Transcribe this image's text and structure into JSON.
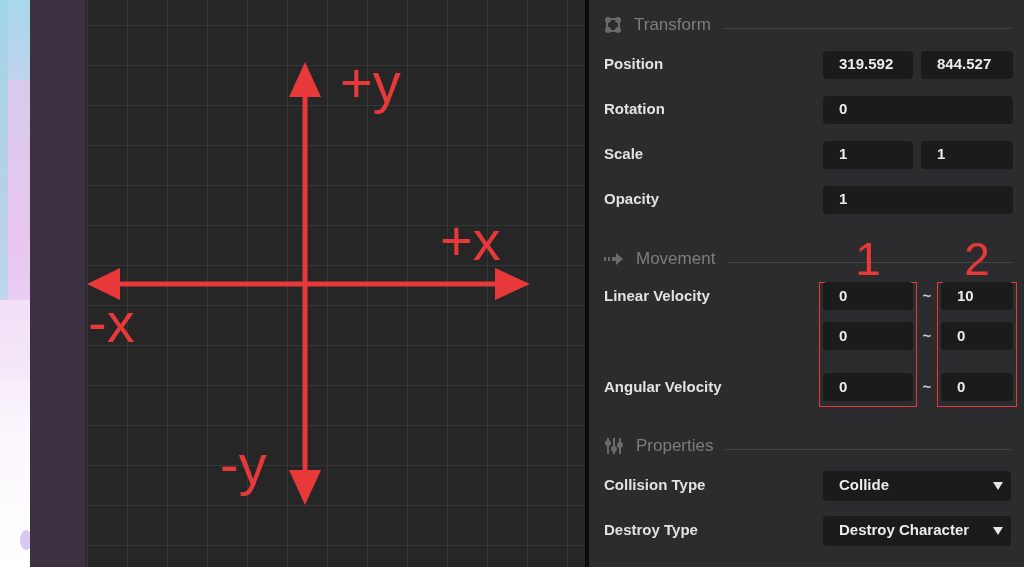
{
  "canvas": {
    "axis_labels": [
      {
        "text": "+y"
      },
      {
        "text": "+x"
      },
      {
        "text": "-x"
      },
      {
        "text": "-y"
      }
    ]
  },
  "inspector": {
    "sections": [
      {
        "title": "Transform",
        "rows": [
          {
            "kind": "fields",
            "label": "Position",
            "fields": [
              "319.592",
              "844.527"
            ]
          },
          {
            "kind": "fields",
            "label": "Rotation",
            "fields": [
              "0"
            ]
          },
          {
            "kind": "fields",
            "label": "Scale",
            "fields": [
              "1",
              "1"
            ]
          },
          {
            "kind": "fields",
            "label": "Opacity",
            "fields": [
              "1"
            ]
          }
        ]
      },
      {
        "title": "Movement",
        "annotations": [
          "1",
          "2"
        ],
        "rows": [
          {
            "kind": "range",
            "label": "Linear Velocity",
            "min": "0",
            "separator": "~",
            "max": "10"
          },
          {
            "kind": "range",
            "min": "0",
            "separator": "~",
            "max": "0"
          },
          {
            "kind": "range",
            "label": "Angular Velocity",
            "min": "0",
            "separator": "~",
            "max": "0"
          }
        ]
      },
      {
        "title": "Properties",
        "rows": [
          {
            "kind": "select",
            "label": "Collision Type",
            "value": "Collide"
          },
          {
            "kind": "select",
            "label": "Destroy Type",
            "value": "Destroy Character"
          }
        ]
      }
    ]
  }
}
